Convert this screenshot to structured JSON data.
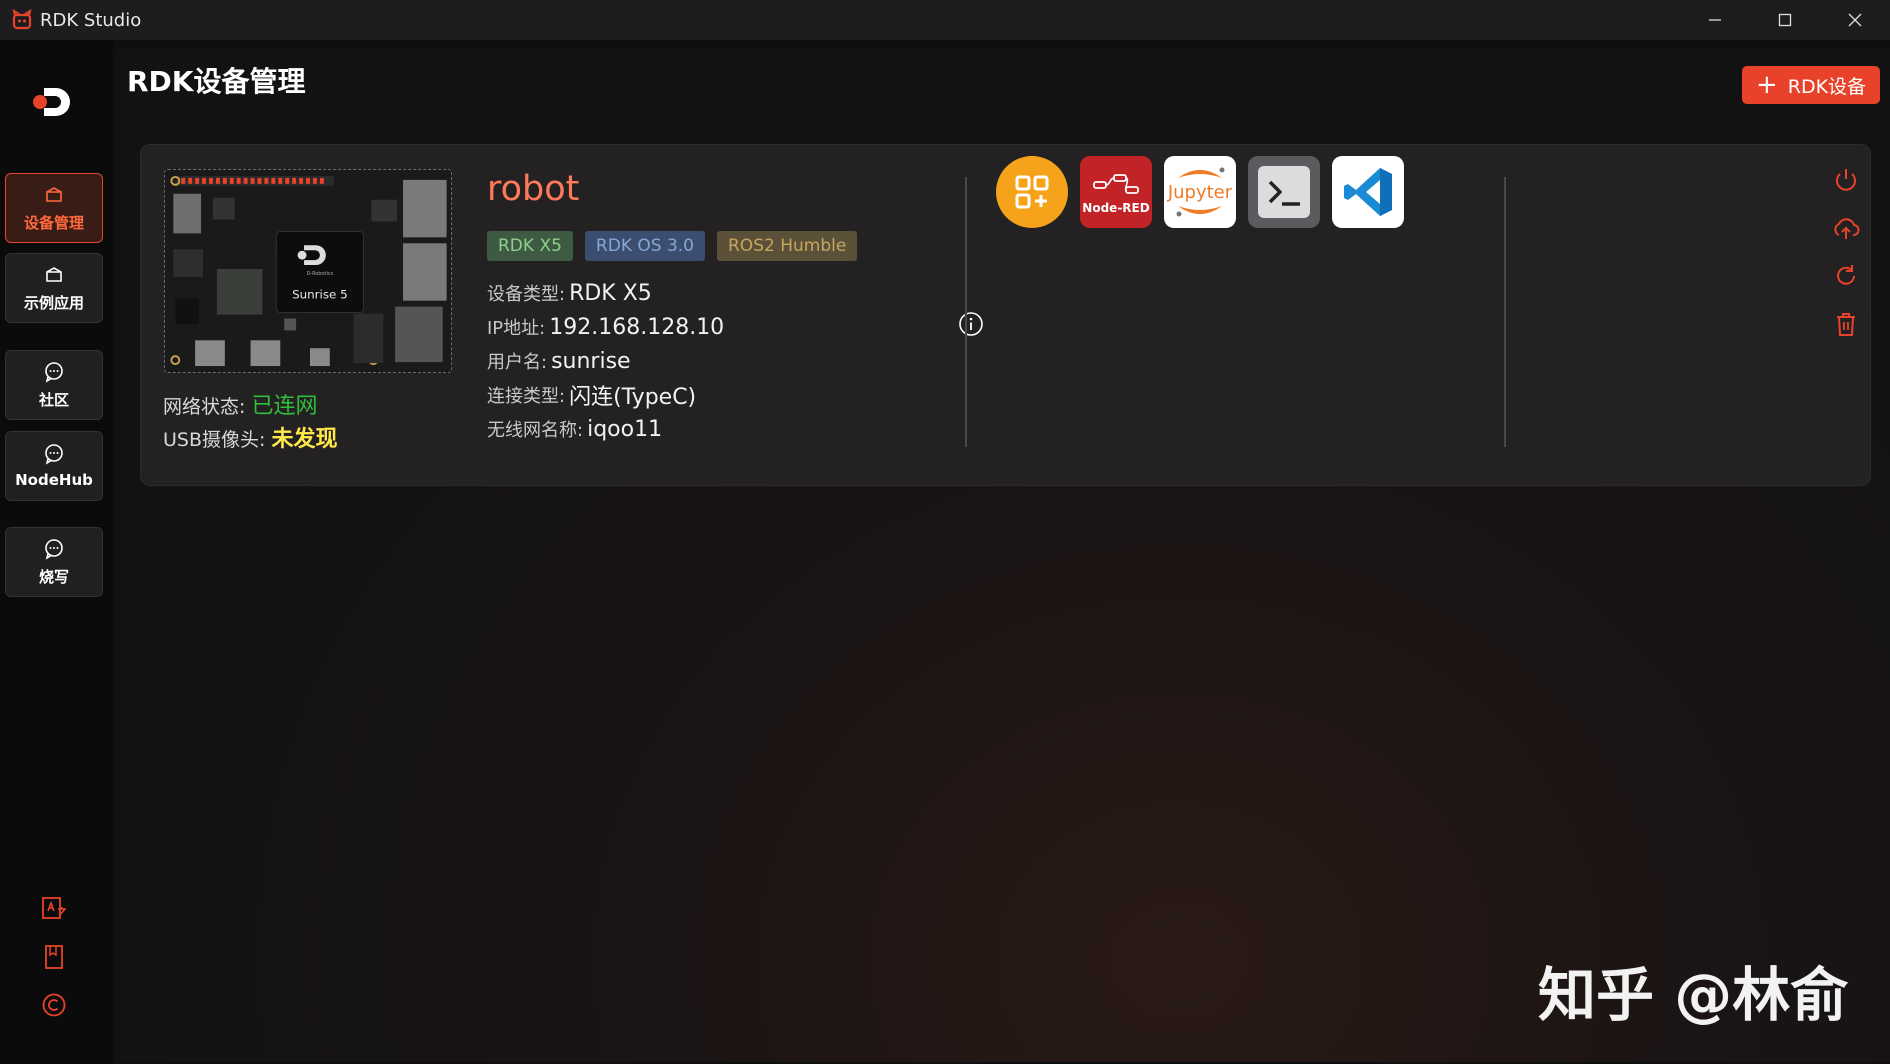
{
  "window": {
    "title": "RDK Studio"
  },
  "sidebar": {
    "items": [
      {
        "label": "设备管理",
        "icon": "box-icon",
        "active": true
      },
      {
        "label": "示例应用",
        "icon": "box-icon",
        "active": false
      },
      {
        "label": "社区",
        "icon": "chat-icon",
        "active": false
      },
      {
        "label": "NodeHub",
        "icon": "chat-icon",
        "active": false
      },
      {
        "label": "烧写",
        "icon": "chat-icon",
        "active": false
      }
    ],
    "bottom_icons": [
      "translate-icon",
      "bookmark-icon",
      "copyright-icon"
    ]
  },
  "main": {
    "title": "RDK设备管理",
    "add_button_label": "RDK设备"
  },
  "device": {
    "name": "robot",
    "tags": [
      "RDK X5",
      "RDK OS 3.0",
      "ROS2 Humble"
    ],
    "board_chip_label": "Sunrise 5",
    "board_brand_label": "D-Robotics",
    "network_label": "网络状态:",
    "network_value": "已连网",
    "usb_label": "USB摄像头:",
    "usb_value": "未发现",
    "info": [
      {
        "label": "设备类型:",
        "value": "RDK X5"
      },
      {
        "label": "IP地址:",
        "value": "192.168.128.10"
      },
      {
        "label": "用户名:",
        "value": "sunrise"
      },
      {
        "label": "连接类型:",
        "value": "闪连(TypeC)"
      },
      {
        "label": "无线网名称:",
        "value": "iqoo11"
      }
    ],
    "tools": [
      {
        "name": "apps-icon"
      },
      {
        "name": "node-red-icon",
        "label": "Node-RED"
      },
      {
        "name": "jupyter-icon",
        "label": "Jupyter"
      },
      {
        "name": "terminal-icon"
      },
      {
        "name": "vscode-icon"
      }
    ],
    "actions": [
      "power-icon",
      "upload-cloud-icon",
      "refresh-icon",
      "trash-icon"
    ]
  },
  "watermark": "知乎 @林俞",
  "colors": {
    "accent": "#e8432a",
    "online": "#2fbf3a",
    "warning": "#ffe84a"
  }
}
